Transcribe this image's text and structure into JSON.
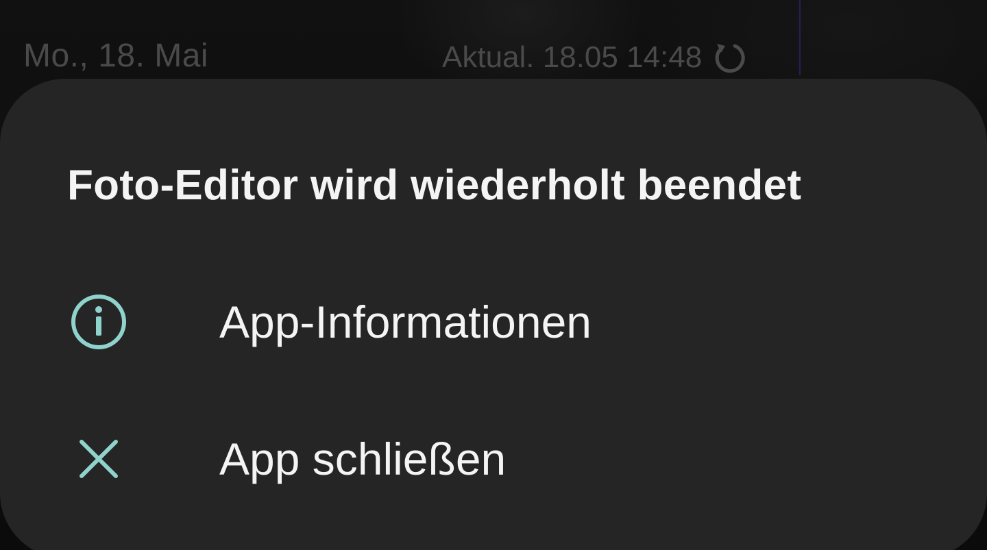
{
  "status_bar": {
    "date": "Mo., 18. Mai",
    "updated": "Aktual. 18.05 14:48",
    "refresh_icon": "refresh-icon"
  },
  "dialog": {
    "title": "Foto-Editor wird wiederholt beendet",
    "items": [
      {
        "label": "App-Informationen",
        "icon": "info-icon"
      },
      {
        "label": "App schließen",
        "icon": "close-icon"
      }
    ]
  },
  "colors": {
    "accent": "#8fd3cc",
    "dialog_background": "#252525",
    "text_primary": "#f4f4f4",
    "text_dimmed": "#4a4a4a"
  }
}
